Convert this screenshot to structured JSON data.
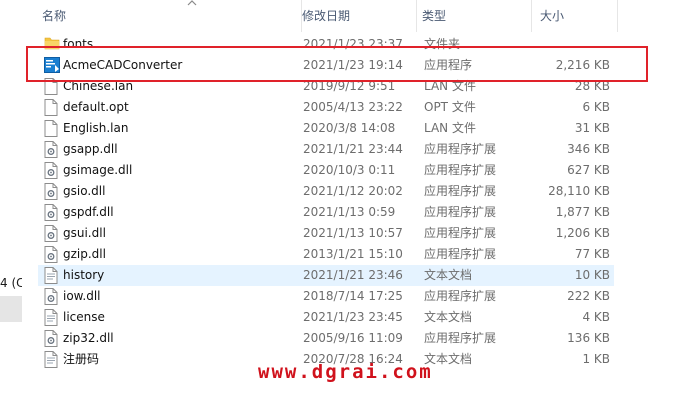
{
  "columns": {
    "name": "名称",
    "date": "修改日期",
    "type": "类型",
    "size": "大小"
  },
  "nav": {
    "drive_label": "4 (C"
  },
  "files": [
    {
      "icon": "folder-icon",
      "name": "fonts",
      "date": "2021/1/23 23:37",
      "type": "文件夹",
      "size": ""
    },
    {
      "icon": "application-icon",
      "name": "AcmeCADConverter",
      "date": "2021/1/23 19:14",
      "type": "应用程序",
      "size": "2,216 KB"
    },
    {
      "icon": "file-icon",
      "name": "Chinese.lan",
      "date": "2019/9/12 9:51",
      "type": "LAN 文件",
      "size": "28 KB"
    },
    {
      "icon": "file-icon",
      "name": "default.opt",
      "date": "2005/4/13 23:22",
      "type": "OPT 文件",
      "size": "6 KB"
    },
    {
      "icon": "file-icon",
      "name": "English.lan",
      "date": "2020/3/8 14:08",
      "type": "LAN 文件",
      "size": "31 KB"
    },
    {
      "icon": "dll-icon",
      "name": "gsapp.dll",
      "date": "2021/1/21 23:44",
      "type": "应用程序扩展",
      "size": "346 KB"
    },
    {
      "icon": "dll-icon",
      "name": "gsimage.dll",
      "date": "2020/10/3 0:11",
      "type": "应用程序扩展",
      "size": "627 KB"
    },
    {
      "icon": "dll-icon",
      "name": "gsio.dll",
      "date": "2021/1/12 20:02",
      "type": "应用程序扩展",
      "size": "28,110 KB"
    },
    {
      "icon": "dll-icon",
      "name": "gspdf.dll",
      "date": "2021/1/13 0:59",
      "type": "应用程序扩展",
      "size": "1,877 KB"
    },
    {
      "icon": "dll-icon",
      "name": "gsui.dll",
      "date": "2021/1/13 10:57",
      "type": "应用程序扩展",
      "size": "1,206 KB"
    },
    {
      "icon": "dll-icon",
      "name": "gzip.dll",
      "date": "2013/1/21 15:10",
      "type": "应用程序扩展",
      "size": "77 KB"
    },
    {
      "icon": "text-file-icon",
      "name": "history",
      "date": "2021/1/21 23:46",
      "type": "文本文档",
      "size": "10 KB"
    },
    {
      "icon": "dll-icon",
      "name": "iow.dll",
      "date": "2018/7/14 17:25",
      "type": "应用程序扩展",
      "size": "222 KB"
    },
    {
      "icon": "text-file-icon",
      "name": "license",
      "date": "2021/1/23 23:45",
      "type": "文本文档",
      "size": "4 KB"
    },
    {
      "icon": "dll-icon",
      "name": "zip32.dll",
      "date": "2005/9/16 11:09",
      "type": "应用程序扩展",
      "size": "136 KB"
    },
    {
      "icon": "text-file-icon",
      "name": "注册码",
      "date": "2020/7/28 16:24",
      "type": "文本文档",
      "size": "1 KB"
    }
  ],
  "selected_index": 11,
  "highlighted_index": 1,
  "watermark": "www.dgrai.com",
  "colors": {
    "highlight_border": "#e0222a",
    "selection": "#e5f3ff",
    "folder": "#f4c542",
    "app_icon": "#1a7fd1"
  }
}
